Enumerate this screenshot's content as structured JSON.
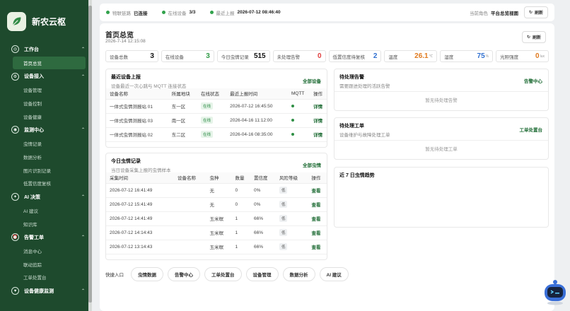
{
  "sidebar": {
    "app_name": "新农云枢",
    "sections": [
      {
        "title": "工作台",
        "items": [
          {
            "label": "首页总览",
            "active": true
          }
        ]
      },
      {
        "title": "设备接入",
        "items": [
          {
            "label": "设备管理"
          },
          {
            "label": "设备控制"
          },
          {
            "label": "设备健康"
          }
        ]
      },
      {
        "title": "监测中心",
        "items": [
          {
            "label": "虫情记录"
          },
          {
            "label": "数据分析"
          },
          {
            "label": "图片识别记录"
          },
          {
            "label": "低置信度复核"
          }
        ]
      },
      {
        "title": "AI 决策",
        "items": [
          {
            "label": "AI 建议"
          },
          {
            "label": "知识库"
          }
        ]
      },
      {
        "title": "告警工单",
        "items": [
          {
            "label": "消息中心"
          },
          {
            "label": "联动追踪"
          },
          {
            "label": "工单处置台"
          }
        ]
      },
      {
        "title": "设备健康监测",
        "items": []
      }
    ]
  },
  "topbar": {
    "iot_label": "物联链路",
    "iot_value": "已连接",
    "online_label": "在线设备",
    "online_value": "3/3",
    "last_report_label": "最近上报",
    "last_report_value": "2026-07-12 08:46:40",
    "role_label": "当前角色",
    "role_value": "平台总览视图",
    "refresh_label": "刷新"
  },
  "page": {
    "title": "首页总览",
    "date": "2026-7-14 12:15:08",
    "refresh_label": "刷新"
  },
  "stats": [
    {
      "label": "设备总数",
      "value": "3",
      "color": "#111111"
    },
    {
      "label": "在线设备",
      "value": "3",
      "color": "#2f9a46"
    },
    {
      "label": "今日虫情记录",
      "value": "515",
      "color": "#111111"
    },
    {
      "label": "未处理告警",
      "value": "0",
      "color": "#e04040"
    },
    {
      "label": "低置信度待复核",
      "value": "2",
      "color": "#2f6fd0"
    },
    {
      "label": "温度",
      "value": "26.1",
      "unit": "℃",
      "color": "#e07a1f"
    },
    {
      "label": "湿度",
      "value": "75",
      "unit": "%",
      "color": "#2f6fd0"
    },
    {
      "label": "光照强度",
      "value": "0",
      "unit": "lux",
      "color": "#e07a1f"
    }
  ],
  "recent_devices": {
    "title": "最近设备上报",
    "subtitle": "设备最近一次心跳与 MQTT 连接状态",
    "action": "全部设备",
    "columns": [
      "设备名称",
      "所属地块",
      "在线状态",
      "最近上报时间",
      "MQTT",
      "操作"
    ],
    "rows": [
      {
        "name": "一体式虫情测报站 01",
        "plot": "东一区",
        "status": "在线",
        "time": "2026-07-12 16:45:50",
        "op": "详情"
      },
      {
        "name": "一体式虫情测报站 03",
        "plot": "南一区",
        "status": "在线",
        "time": "2026-04-16 11:12:00",
        "op": "详情"
      },
      {
        "name": "一体式虫情测报站 02",
        "plot": "东二区",
        "status": "在线",
        "time": "2026-04-16 08:35:00",
        "op": "详情"
      }
    ]
  },
  "today_pests": {
    "title": "今日虫情记录",
    "subtitle": "当日设备采集上报的虫情样本",
    "action": "全部虫情",
    "columns": [
      "采集时间",
      "设备名称",
      "虫种",
      "数量",
      "置信度",
      "风险等级",
      "操作"
    ],
    "rows": [
      {
        "time": "2026-07-12 16:41:49",
        "device": "",
        "species": "无",
        "count": "0",
        "conf": "0%",
        "risk": "低",
        "op": "查看"
      },
      {
        "time": "2026-07-12 15:41:49",
        "device": "",
        "species": "无",
        "count": "0",
        "conf": "0%",
        "risk": "低",
        "op": "查看"
      },
      {
        "time": "2026-07-12 14:41:49",
        "device": "",
        "species": "玉米螟",
        "count": "1",
        "conf": "66%",
        "risk": "低",
        "op": "查看"
      },
      {
        "time": "2026-07-12 14:14:43",
        "device": "",
        "species": "玉米螟",
        "count": "1",
        "conf": "66%",
        "risk": "低",
        "op": "查看"
      },
      {
        "time": "2026-07-12 13:14:43",
        "device": "",
        "species": "玉米螟",
        "count": "1",
        "conf": "66%",
        "risk": "低",
        "op": "查看"
      }
    ]
  },
  "alerts_card": {
    "title": "待处理告警",
    "subtitle": "需要跟进处理的活跃告警",
    "action": "告警中心",
    "empty": "暂无待处理告警"
  },
  "workorders_card": {
    "title": "待处理工单",
    "subtitle": "设备维护与故障处理工单",
    "action": "工单处置台",
    "empty": "暂无待处理工单"
  },
  "trend_card": {
    "title": "近 7 日虫情趋势"
  },
  "quick": {
    "label": "快捷入口",
    "links": [
      "虫情数据",
      "告警中心",
      "工单处置台",
      "设备管理",
      "数据分析",
      "AI 建议"
    ]
  },
  "colors": {
    "sidebar": "#1e4a2d",
    "accent": "#1e6b34"
  }
}
